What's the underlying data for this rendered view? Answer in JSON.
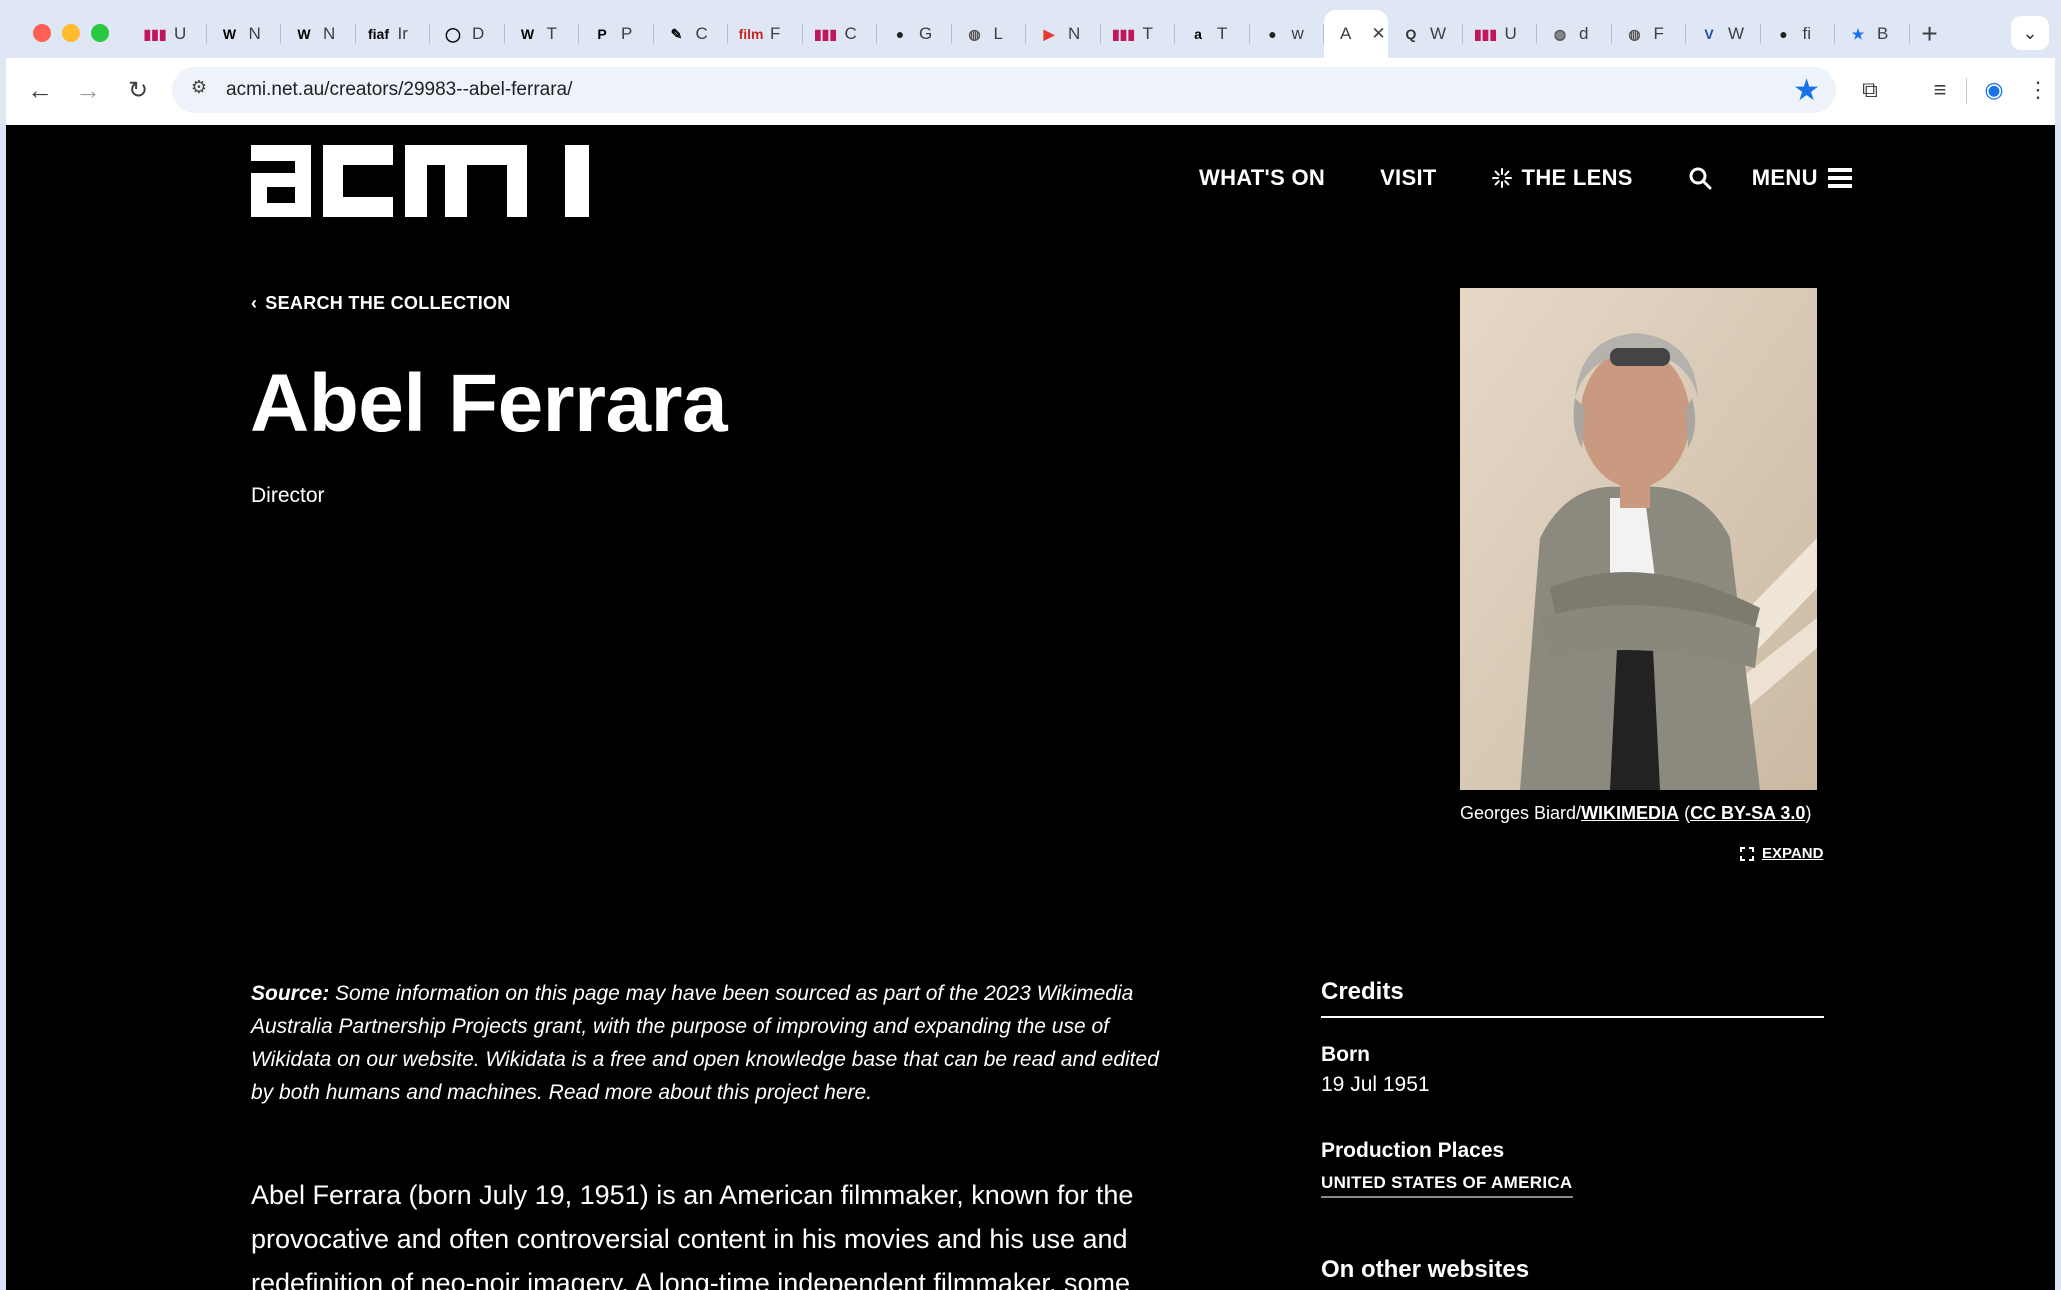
{
  "browser": {
    "tabs": [
      {
        "icon": "▮▮▮",
        "label": "U",
        "color": "#c2185b"
      },
      {
        "icon": "W",
        "label": "N",
        "color": "#000"
      },
      {
        "icon": "W",
        "label": "N",
        "color": "#000"
      },
      {
        "icon": "fiaf",
        "label": "Ir",
        "color": "#000"
      },
      {
        "icon": "◯",
        "label": "D",
        "color": "#000"
      },
      {
        "icon": "W",
        "label": "T",
        "color": "#000"
      },
      {
        "icon": "P",
        "label": "P",
        "color": "#000"
      },
      {
        "icon": "✎",
        "label": "C",
        "color": "#000"
      },
      {
        "icon": "film",
        "label": "F",
        "color": "#c62828"
      },
      {
        "icon": "▮▮▮",
        "label": "C",
        "color": "#c2185b"
      },
      {
        "icon": "●",
        "label": "G",
        "color": "#222"
      },
      {
        "icon": "◍",
        "label": "L",
        "color": "#555"
      },
      {
        "icon": "▶",
        "label": "N",
        "color": "#e53935"
      },
      {
        "icon": "▮▮▮",
        "label": "T",
        "color": "#c2185b"
      },
      {
        "icon": "a",
        "label": "T",
        "color": "#000"
      },
      {
        "icon": "●",
        "label": "w",
        "color": "#222"
      }
    ],
    "active_tab": {
      "label": "A",
      "close": "✕"
    },
    "tabs_after": [
      {
        "icon": "Q",
        "label": "W",
        "color": "#333"
      },
      {
        "icon": "▮▮▮",
        "label": "U",
        "color": "#c2185b"
      },
      {
        "icon": "◍",
        "label": "d",
        "color": "#555"
      },
      {
        "icon": "◍",
        "label": "F",
        "color": "#555"
      },
      {
        "icon": "V",
        "label": "W",
        "color": "#1a4fa0"
      },
      {
        "icon": "●",
        "label": "fi",
        "color": "#222"
      },
      {
        "icon": "★",
        "label": "B",
        "color": "#1a73e8"
      }
    ],
    "new_tab": "+",
    "url": "acmi.net.au/creators/29983--abel-ferrara/"
  },
  "nav": {
    "whats_on": "WHAT'S ON",
    "visit": "VISIT",
    "lens": "THE LENS",
    "menu": "MENU"
  },
  "page": {
    "back_link": "SEARCH THE COLLECTION",
    "name": "Abel Ferrara",
    "role": "Director",
    "caption_author": "Georges Biard/",
    "caption_source": "WIKIMEDIA",
    "caption_license": "CC BY-SA 3.0",
    "expand": "EXPAND",
    "source_label": "Source:",
    "source_text": " Some information on this page may have been sourced as part of the 2023 Wikimedia Australia Partnership Projects grant, with the purpose of improving and expanding the use of Wikidata on our website. Wikidata is a free and open knowledge base that can be read and edited by both humans and machines. Read more about this project here.",
    "bio": "Abel Ferrara (born July 19, 1951) is an American filmmaker, known for the provocative and often controversial content in his movies and his use and redefinition of neo-noir imagery. A long-time independent filmmaker, some"
  },
  "credits": {
    "heading": "Credits",
    "born_label": "Born",
    "born_value": "19 Jul 1951",
    "places_label": "Production Places",
    "places_value": "UNITED STATES OF AMERICA",
    "other_heading": "On other websites"
  }
}
